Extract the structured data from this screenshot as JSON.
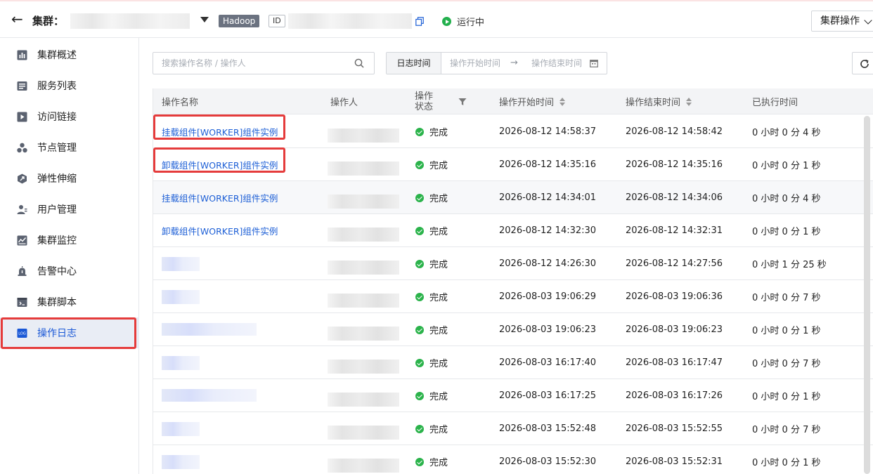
{
  "header": {
    "back_label": "←",
    "cluster_label": "集群：",
    "tag_type": "Hadoop",
    "tag_id": "ID",
    "status": "运行中",
    "cluster_ops": "集群操作"
  },
  "sidebar": {
    "items": [
      {
        "label": "集群概述",
        "icon": "bar-chart-icon"
      },
      {
        "label": "服务列表",
        "icon": "list-icon"
      },
      {
        "label": "访问链接",
        "icon": "play-window-icon"
      },
      {
        "label": "节点管理",
        "icon": "nodes-icon"
      },
      {
        "label": "弹性伸缩",
        "icon": "scale-icon"
      },
      {
        "label": "用户管理",
        "icon": "user-icon"
      },
      {
        "label": "集群监控",
        "icon": "monitor-icon"
      },
      {
        "label": "告警中心",
        "icon": "alarm-icon"
      },
      {
        "label": "集群脚本",
        "icon": "script-icon"
      },
      {
        "label": "操作日志",
        "icon": "log-icon",
        "active": true
      }
    ]
  },
  "toolbar": {
    "search_placeholder": "搜索操作名称 / 操作人",
    "log_time_label": "日志时间",
    "start_placeholder": "操作开始时间",
    "arrow": "→",
    "end_placeholder": "操作结束时间"
  },
  "table": {
    "columns": [
      "操作名称",
      "操作人",
      "操作状态",
      "操作开始时间",
      "操作结束时间",
      "已执行时间"
    ],
    "rows": [
      {
        "name": "挂载组件[WORKER]组件实例",
        "status": "完成",
        "start": "2026-08-12 14:58:37",
        "end": "2026-08-12 14:58:42",
        "elapsed": "0 小时 0 分 4 秒"
      },
      {
        "name": "卸载组件[WORKER]组件实例",
        "status": "完成",
        "start": "2026-08-12 14:35:16",
        "end": "2026-08-12 14:35:16",
        "elapsed": "0 小时 0 分 1 秒"
      },
      {
        "name": "挂载组件[WORKER]组件实例",
        "status": "完成",
        "start": "2026-08-12 14:34:01",
        "end": "2026-08-12 14:34:06",
        "elapsed": "0 小时 0 分 4 秒"
      },
      {
        "name": "卸载组件[WORKER]组件实例",
        "status": "完成",
        "start": "2026-08-12 14:32:30",
        "end": "2026-08-12 14:32:31",
        "elapsed": "0 小时 0 分 1 秒"
      },
      {
        "name": "",
        "status": "完成",
        "start": "2026-08-12 14:26:30",
        "end": "2026-08-12 14:27:56",
        "elapsed": "0 小时 1 分 25 秒"
      },
      {
        "name": "",
        "status": "完成",
        "start": "2026-08-03 19:06:29",
        "end": "2026-08-03 19:06:36",
        "elapsed": "0 小时 0 分 7 秒"
      },
      {
        "name": "",
        "status": "完成",
        "start": "2026-08-03 19:06:23",
        "end": "2026-08-03 19:06:23",
        "elapsed": "0 小时 0 分 1 秒"
      },
      {
        "name": "",
        "status": "完成",
        "start": "2026-08-03 16:17:40",
        "end": "2026-08-03 16:17:47",
        "elapsed": "0 小时 0 分 7 秒"
      },
      {
        "name": "",
        "status": "完成",
        "start": "2026-08-03 16:17:25",
        "end": "2026-08-03 16:17:26",
        "elapsed": "0 小时 0 分 1 秒"
      },
      {
        "name": "",
        "status": "完成",
        "start": "2026-08-03 15:52:48",
        "end": "2026-08-03 15:52:55",
        "elapsed": "0 小时 0 分 7 秒"
      },
      {
        "name": "",
        "status": "完成",
        "start": "2026-08-03 15:52:30",
        "end": "2026-08-03 15:52:31",
        "elapsed": "0 小时 0 分 1 秒"
      }
    ]
  },
  "colors": {
    "accent": "#1d5fd6",
    "success": "#2bb34b",
    "highlight_box": "#e53b3b"
  }
}
